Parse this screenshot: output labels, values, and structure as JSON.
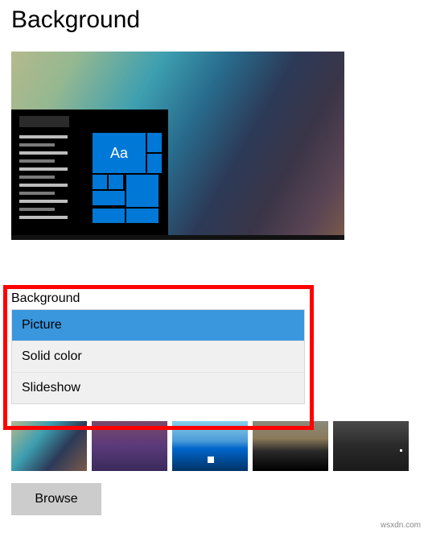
{
  "title": "Background",
  "preview": {
    "tile_text": "Aa"
  },
  "dropdown": {
    "label": "Background",
    "options": [
      {
        "label": "Picture",
        "selected": true
      },
      {
        "label": "Solid color",
        "selected": false
      },
      {
        "label": "Slideshow",
        "selected": false
      }
    ]
  },
  "browse_label": "Browse",
  "watermark": "wsxdn.com"
}
